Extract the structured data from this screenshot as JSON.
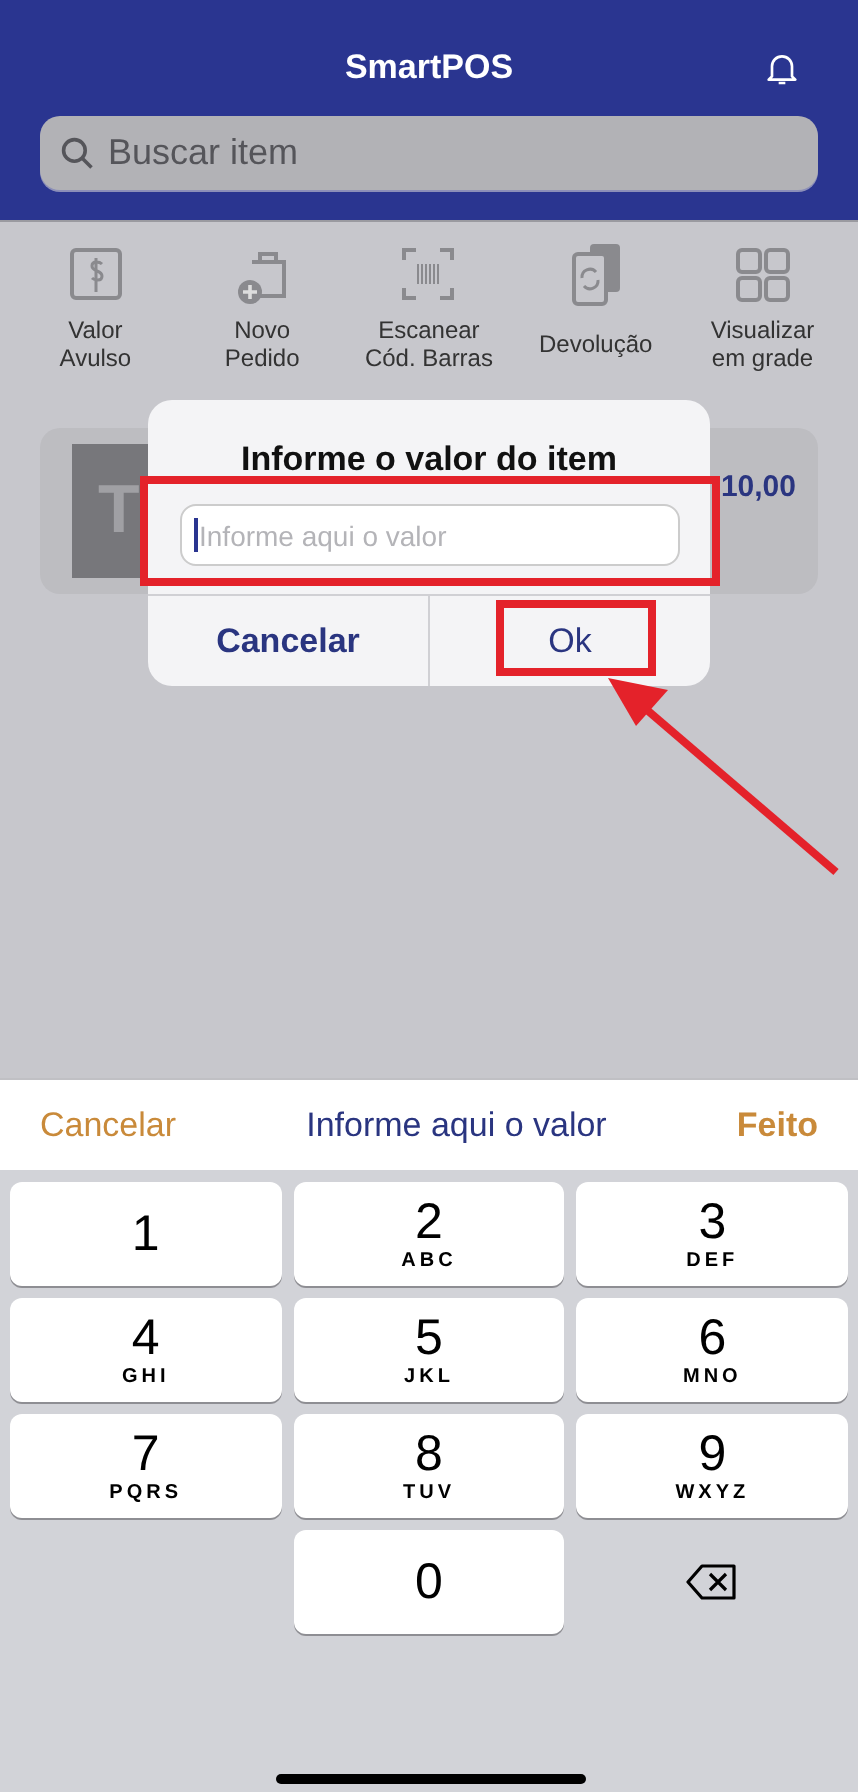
{
  "header": {
    "title": "SmartPOS"
  },
  "search": {
    "placeholder": "Buscar item"
  },
  "actions": [
    {
      "kind": "dollar",
      "label": "Valor\nAvulso"
    },
    {
      "kind": "new-order",
      "label": "Novo\nPedido"
    },
    {
      "kind": "barcode",
      "label": "Escanear\nCód. Barras"
    },
    {
      "kind": "return",
      "label": "Devolução"
    },
    {
      "kind": "grid",
      "label": "Visualizar\nem grade"
    }
  ],
  "item_card": {
    "thumbnail_text": "T",
    "price": "10,00"
  },
  "dialog": {
    "title": "Informe o valor do item",
    "field": {
      "placeholder": "Informe aqui o valor",
      "focused": true
    },
    "buttons": [
      {
        "kind": "cancel",
        "label": "Cancelar"
      },
      {
        "kind": "confirm",
        "label": "Ok"
      }
    ]
  },
  "annotations": {
    "field_highlight": true,
    "ok_highlight": true,
    "arrow": true
  },
  "keyboard": {
    "toolbar": {
      "cancel": "Cancelar",
      "prompt": "Informe aqui o valor",
      "done": "Feito"
    },
    "keys": [
      {
        "kind": "digit",
        "digit": "1"
      },
      {
        "kind": "digit",
        "digit": "2",
        "letters": "ABC"
      },
      {
        "kind": "digit",
        "digit": "3",
        "letters": "DEF"
      },
      {
        "kind": "digit",
        "digit": "4",
        "letters": "GHI"
      },
      {
        "kind": "digit",
        "digit": "5",
        "letters": "JKL"
      },
      {
        "kind": "digit",
        "digit": "6",
        "letters": "MNO"
      },
      {
        "kind": "digit",
        "digit": "7",
        "letters": "PQRS"
      },
      {
        "kind": "digit",
        "digit": "8",
        "letters": "TUV"
      },
      {
        "kind": "digit",
        "digit": "9",
        "letters": "WXYZ"
      },
      {
        "kind": "blank"
      },
      {
        "kind": "digit",
        "digit": "0"
      },
      {
        "kind": "delete"
      }
    ]
  }
}
